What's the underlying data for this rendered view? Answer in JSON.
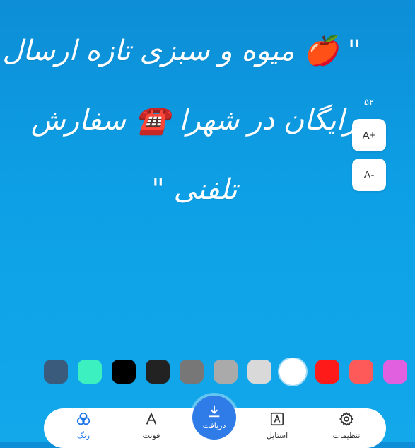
{
  "headline": {
    "line1": "\" 🍎 میوه و سبزی تازه ارسال",
    "line2": "رایگان در شهرا ☎️ سفارش",
    "line3": "تلفنی \""
  },
  "font_size": {
    "value": "۵۲",
    "increase_label": "A+",
    "decrease_label": "A-"
  },
  "colors": {
    "background_top": "#0d8ed6",
    "background_bottom": "#12a8ea",
    "text": "#ffffff",
    "accent": "#2f7be8",
    "swatches": [
      "#3a5b7c",
      "#3cf0c0",
      "#000000",
      "#222222",
      "#777777",
      "#aaaaaa",
      "#d9d9d9",
      "#ffffff",
      "#ff1a1a",
      "#ff5a5a",
      "#e060e0"
    ],
    "selected_swatch": "#ffffff"
  },
  "nav": {
    "settings_label": "تنظیمات",
    "style_label": "استایل",
    "download_label": "دریافت",
    "font_label": "فونت",
    "color_label": "رنگ",
    "active": "color"
  }
}
